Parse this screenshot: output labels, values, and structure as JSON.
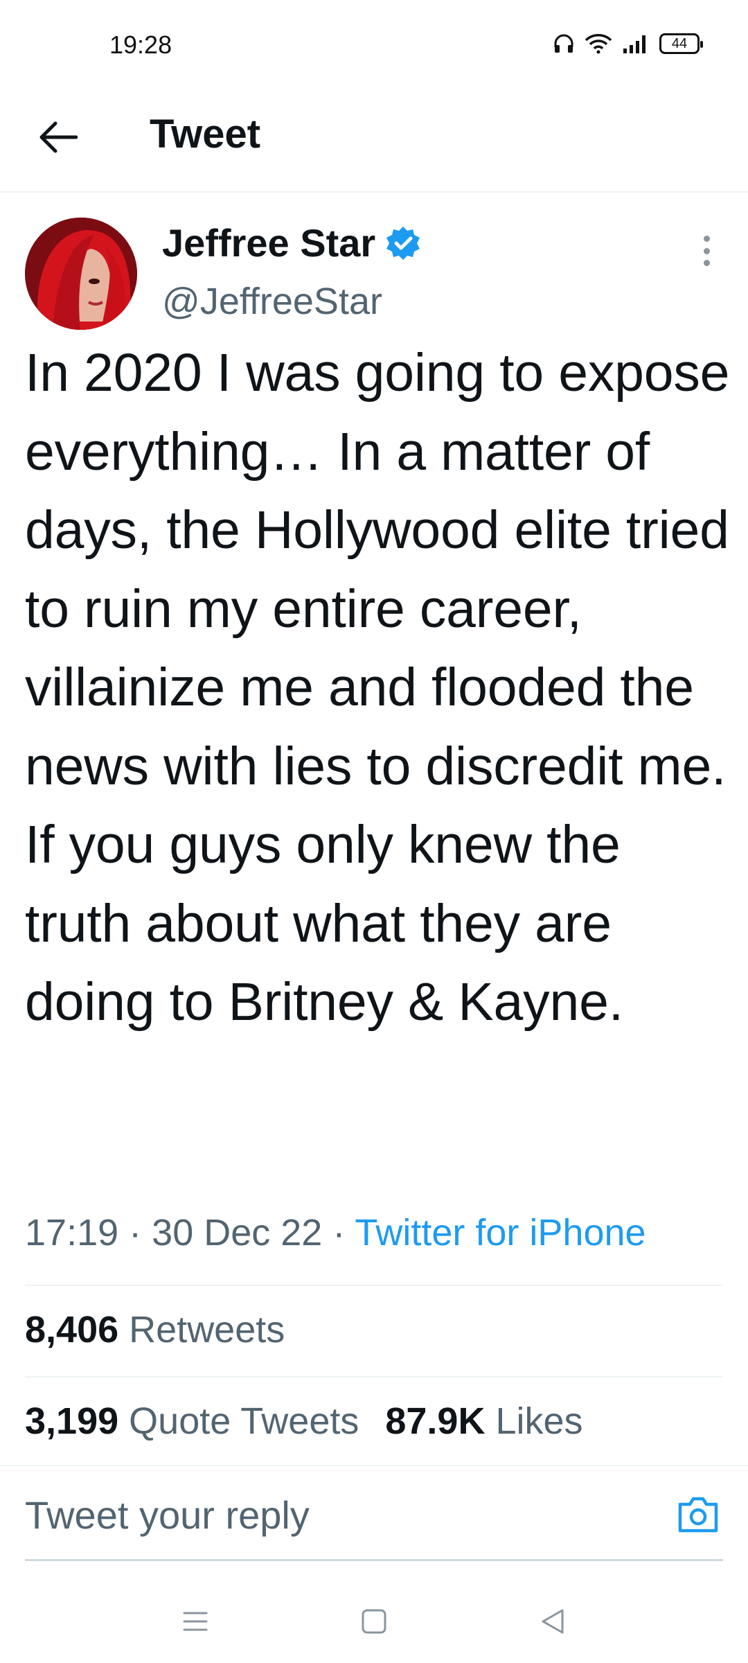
{
  "status_bar": {
    "time": "19:28",
    "battery": "44",
    "icons": [
      "headset-icon",
      "wifi-icon",
      "signal-icon",
      "battery-icon"
    ]
  },
  "header": {
    "title": "Tweet",
    "back_icon": "back-arrow-icon"
  },
  "tweet": {
    "author_name": "Jeffree Star",
    "verified": true,
    "handle": "@JeffreeStar",
    "text": "In 2020 I was going to expose everything… In a matter of days, the Hollywood elite tried to ruin my entire career, villainize me and flooded the news with lies to discredit me. If you guys only knew the truth about what they are doing to Britney & Kayne.",
    "time": "17:19",
    "separator": "·",
    "date": "30 Dec 22",
    "source": "Twitter for iPhone"
  },
  "stats": {
    "retweets_count": "8,406",
    "retweets_label": "Retweets",
    "quote_count": "3,199",
    "quote_label": "Quote Tweets",
    "likes_count": "87.9K",
    "likes_label": "Likes"
  },
  "reply": {
    "placeholder": "Tweet your reply"
  },
  "colors": {
    "accent": "#1d9bf0",
    "text": "#0f1419",
    "secondary": "#536471",
    "divider": "#eff3f4"
  }
}
